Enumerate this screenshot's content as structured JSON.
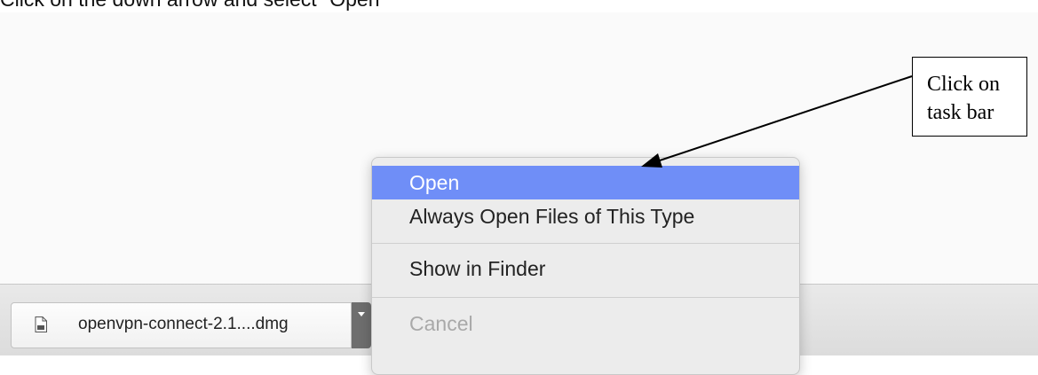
{
  "instruction": "Click on the down arrow and select \"Open\"",
  "callout": {
    "line1": "Click on",
    "line2": "task bar"
  },
  "download": {
    "file_name": "openvpn-connect-2.1....dmg",
    "icon": "document-icon",
    "toggle_icon": "chevron-down-icon"
  },
  "context_menu": {
    "items": [
      {
        "label": "Open",
        "highlighted": true
      },
      {
        "label": "Always Open Files of This Type"
      },
      {
        "label": "Show in Finder"
      },
      {
        "label": "Cancel",
        "disabled": true
      }
    ]
  },
  "colors": {
    "highlight": "#6f8ef7",
    "toggle": "#6e6e6e"
  }
}
